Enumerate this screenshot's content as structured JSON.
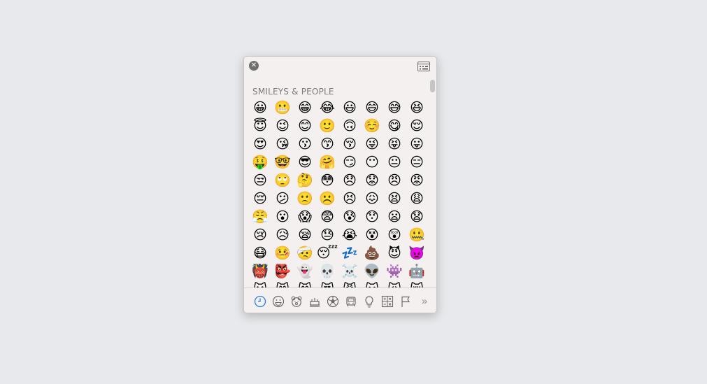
{
  "section_title": "SMILEYS & PEOPLE",
  "close_glyph": "✕",
  "more_glyph": "»",
  "emojis": [
    "😀",
    "😬",
    "😁",
    "😂",
    "😃",
    "😄",
    "😅",
    "😆",
    "😇",
    "😉",
    "😊",
    "🙂",
    "🙃",
    "☺️",
    "😋",
    "😌",
    "😍",
    "😘",
    "😗",
    "😙",
    "😚",
    "😜",
    "😝",
    "😛",
    "🤑",
    "🤓",
    "😎",
    "🤗",
    "😏",
    "😶",
    "😐",
    "😑",
    "😒",
    "🙄",
    "🤔",
    "😳",
    "😞",
    "😟",
    "😠",
    "😡",
    "😔",
    "😕",
    "🙁",
    "☹️",
    "😣",
    "😖",
    "😫",
    "😩",
    "😤",
    "😮",
    "😱",
    "😨",
    "😰",
    "😯",
    "😦",
    "😧",
    "😢",
    "😥",
    "😪",
    "😓",
    "😭",
    "😵",
    "😲",
    "🤐",
    "😷",
    "🤒",
    "🤕",
    "😴",
    "💤",
    "💩",
    "😈",
    "👿",
    "👹",
    "👺",
    "👻",
    "💀",
    "☠️",
    "👽",
    "👾",
    "🤖",
    "😺",
    "😸",
    "😹",
    "😻",
    "😼",
    "😽",
    "🙀",
    "😿"
  ],
  "categories": [
    "recent-clock-icon",
    "smiley-icon",
    "bear-icon",
    "food-icon",
    "ball-icon",
    "car-icon",
    "lightbulb-icon",
    "symbols-icon",
    "flag-icon"
  ],
  "colors": {
    "active_category": "#2f7de1",
    "icon_gray": "#6b6867"
  }
}
